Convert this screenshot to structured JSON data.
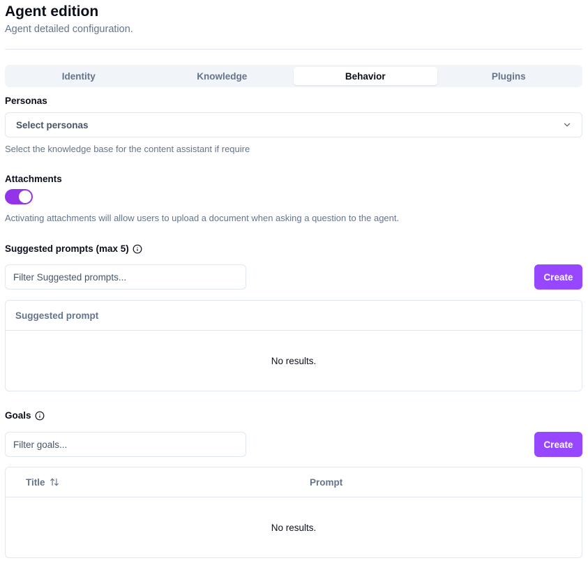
{
  "header": {
    "title": "Agent edition",
    "subtitle": "Agent detailed configuration."
  },
  "tabs": [
    {
      "label": "Identity",
      "active": false
    },
    {
      "label": "Knowledge",
      "active": false
    },
    {
      "label": "Behavior",
      "active": true
    },
    {
      "label": "Plugins",
      "active": false
    }
  ],
  "personas": {
    "label": "Personas",
    "select_value": "Select personas",
    "hint": "Select the knowledge base for the content assistant if require"
  },
  "attachments": {
    "label": "Attachments",
    "enabled": true,
    "hint": "Activating attachments will allow users to upload a document when asking a question to the agent."
  },
  "suggested_prompts": {
    "label": "Suggested prompts (max 5)",
    "filter_placeholder": "Filter Suggested prompts...",
    "create_label": "Create",
    "columns": [
      "Suggested prompt"
    ],
    "empty_text": "No results."
  },
  "goals": {
    "label": "Goals",
    "filter_placeholder": "Filter goals...",
    "create_label": "Create",
    "columns": [
      "Title",
      "Prompt"
    ],
    "empty_text": "No results."
  },
  "colors": {
    "accent": "#9747ff",
    "toggle_on": "#9333ea"
  }
}
